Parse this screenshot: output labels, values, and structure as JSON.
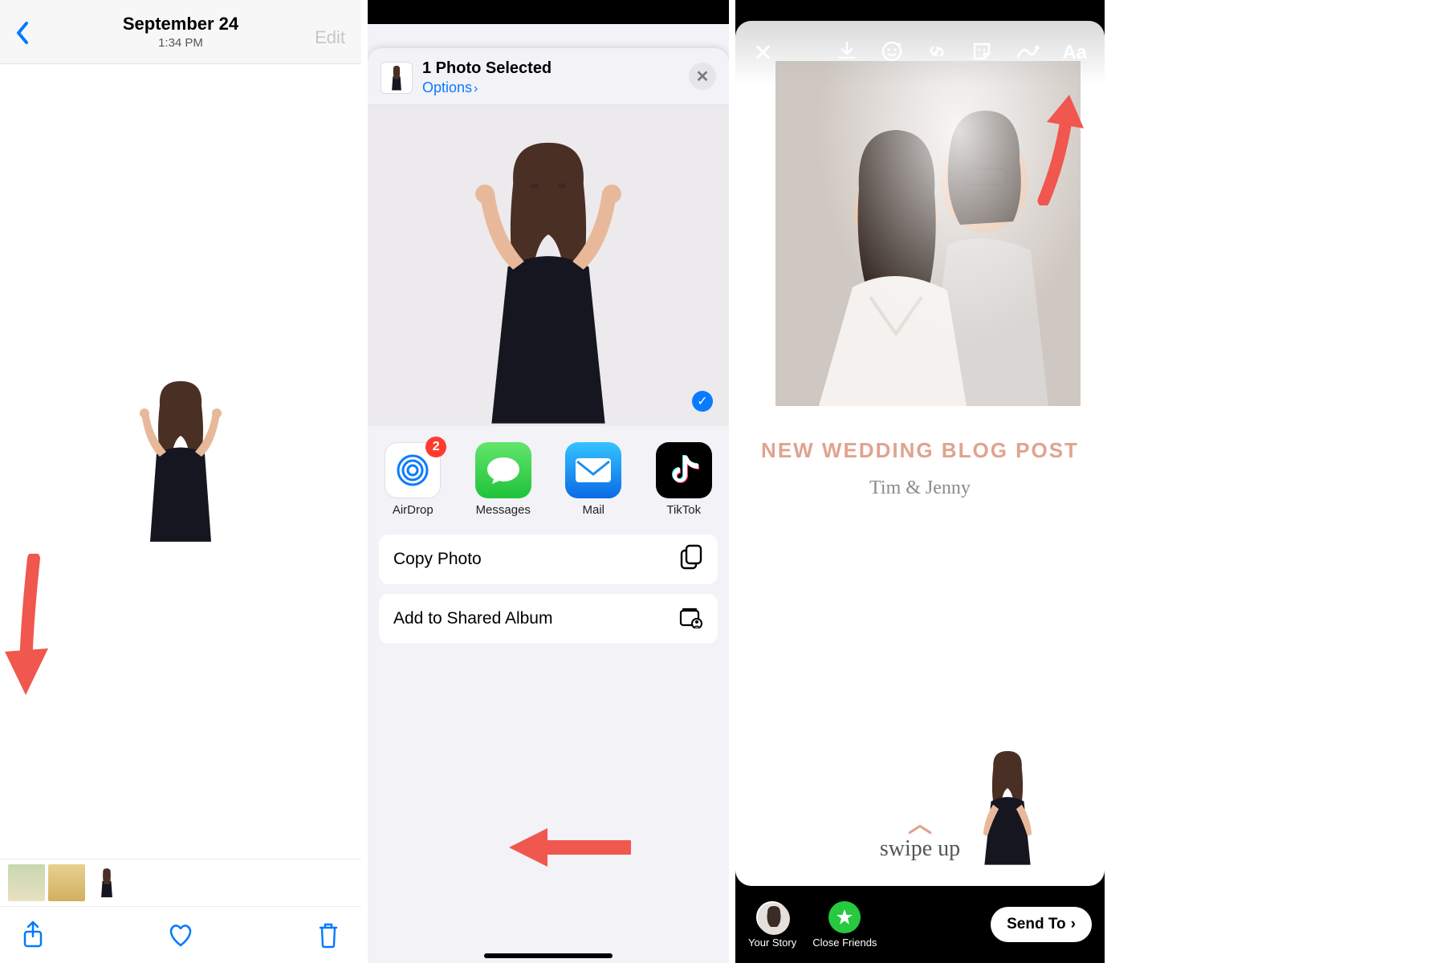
{
  "panel1": {
    "date_title": "September 24",
    "time": "1:34 PM",
    "edit_label": "Edit",
    "toolbar": {
      "share": "share-icon",
      "heart": "heart-icon",
      "trash": "trash-icon"
    }
  },
  "panel2": {
    "header_title": "1 Photo Selected",
    "options_label": "Options",
    "airdrop_badge": "2",
    "apps": {
      "airdrop": "AirDrop",
      "messages": "Messages",
      "mail": "Mail",
      "tiktok": "TikTok"
    },
    "actions": {
      "copy_photo": "Copy Photo",
      "add_shared": "Add to Shared Album"
    }
  },
  "panel3": {
    "title_line": "NEW WEDDING BLOG POST",
    "subtitle": "Tim & Jenny",
    "swipe_label": "swipe up",
    "bottom": {
      "your_story": "Your Story",
      "close_friends": "Close Friends",
      "send_to": "Send To"
    },
    "top_text_icon": "Aa"
  },
  "colors": {
    "ios_blue": "#007aff",
    "accent_peach": "#e0a38e",
    "annot_red": "#f0574e"
  }
}
